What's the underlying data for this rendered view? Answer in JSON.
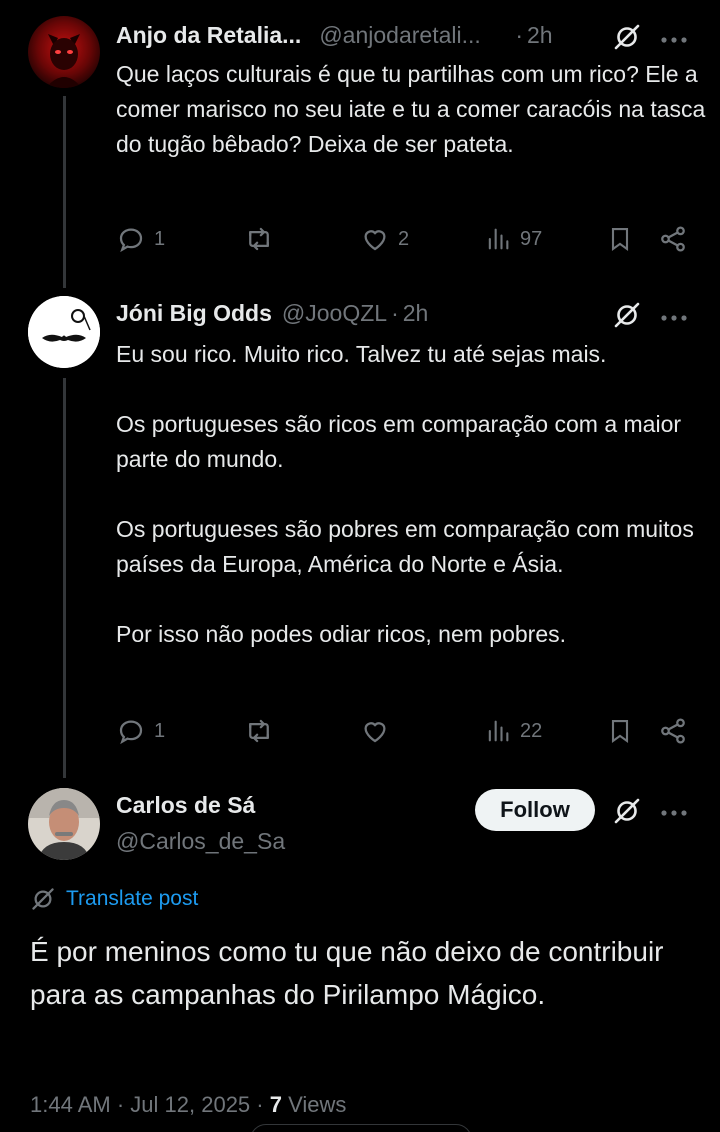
{
  "tweets": [
    {
      "name": "Anjo da Retalia...",
      "handle": "@anjodaretali...",
      "dot": "·",
      "time": "2h",
      "text": [
        "Que laços culturais é que tu partilhas com um rico? Ele a comer marisco no seu iate e tu a comer caracóis na tasca do tugão bêbado? Deixa de ser pateta."
      ],
      "replies": "1",
      "likes": "2",
      "views": "97"
    },
    {
      "name": "Jóni Big Odds",
      "handle": "@JooQZL",
      "dot": "·",
      "time": "2h",
      "text": [
        "Eu sou rico. Muito rico. Talvez tu até sejas mais.",
        "Os portugueses são ricos em comparação com a maior parte do mundo.",
        "Os portugueses são pobres em comparação com muitos países da Europa, América do Norte e Ásia.",
        "Por isso não podes odiar ricos, nem pobres."
      ],
      "replies": "1",
      "likes": "",
      "views": "22"
    }
  ],
  "main_post": {
    "name": "Carlos de Sá",
    "handle": "@Carlos_de_Sa",
    "follow_label": "Follow",
    "translate_label": "Translate post",
    "text": "É por meninos como tu que não deixo de contribuir para as campanhas do Pirilampo Mágico.",
    "time": "1:44 AM",
    "sep1": "·",
    "date": "Jul 12, 2025",
    "sep2": "·",
    "views_count": "7",
    "views_label": "Views"
  },
  "colors": {
    "background": "#000000",
    "text": "#e7e9ea",
    "muted": "#71767b",
    "link": "#1d9bf0",
    "thread_line": "#333639"
  }
}
